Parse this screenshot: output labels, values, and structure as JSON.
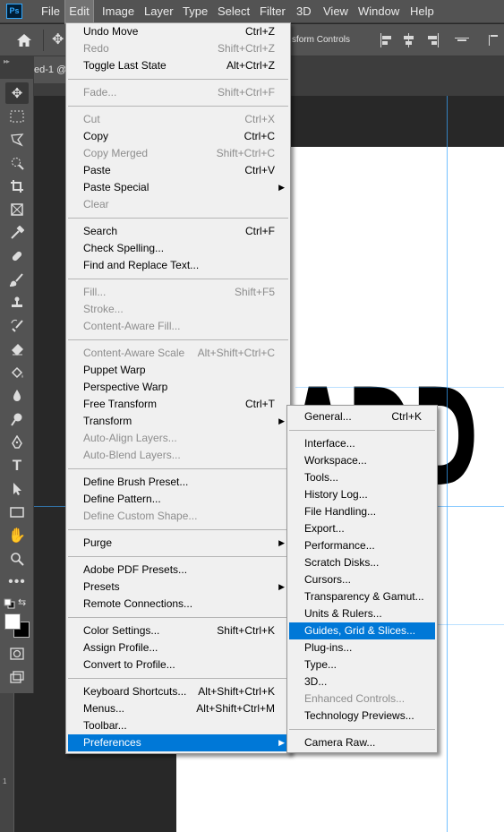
{
  "menubar": {
    "logo": "Ps",
    "items": [
      "File",
      "Edit",
      "Image",
      "Layer",
      "Type",
      "Select",
      "Filter",
      "3D",
      "View",
      "Window",
      "Help"
    ]
  },
  "options_bar": {
    "transform_controls": "sform Controls"
  },
  "document": {
    "tab_label": "ed-1 @",
    "canvas_text": "ADD",
    "ruler_number": "1"
  },
  "tools": [
    "move-tool",
    "marquee-tool",
    "lasso-tool",
    "quick-selection-tool",
    "crop-tool",
    "frame-tool",
    "eyedropper-tool",
    "healing-brush-tool",
    "brush-tool",
    "clone-stamp-tool",
    "history-brush-tool",
    "eraser-tool",
    "paint-bucket-tool",
    "blur-tool",
    "dodge-tool",
    "pen-tool",
    "type-tool",
    "path-selection-tool",
    "rectangle-tool",
    "hand-tool",
    "zoom-tool",
    "more-tools"
  ],
  "edit_menu": [
    {
      "label": "Undo Move",
      "shortcut": "Ctrl+Z",
      "enabled": true
    },
    {
      "label": "Redo",
      "shortcut": "Shift+Ctrl+Z",
      "enabled": false
    },
    {
      "label": "Toggle Last State",
      "shortcut": "Alt+Ctrl+Z",
      "enabled": true
    },
    {
      "separator": true
    },
    {
      "label": "Fade...",
      "shortcut": "Shift+Ctrl+F",
      "enabled": false
    },
    {
      "separator": true
    },
    {
      "label": "Cut",
      "shortcut": "Ctrl+X",
      "enabled": false
    },
    {
      "label": "Copy",
      "shortcut": "Ctrl+C",
      "enabled": true
    },
    {
      "label": "Copy Merged",
      "shortcut": "Shift+Ctrl+C",
      "enabled": false
    },
    {
      "label": "Paste",
      "shortcut": "Ctrl+V",
      "enabled": true
    },
    {
      "label": "Paste Special",
      "shortcut": "",
      "enabled": true,
      "submenu": true
    },
    {
      "label": "Clear",
      "shortcut": "",
      "enabled": false
    },
    {
      "separator": true
    },
    {
      "label": "Search",
      "shortcut": "Ctrl+F",
      "enabled": true
    },
    {
      "label": "Check Spelling...",
      "shortcut": "",
      "enabled": true
    },
    {
      "label": "Find and Replace Text...",
      "shortcut": "",
      "enabled": true
    },
    {
      "separator": true
    },
    {
      "label": "Fill...",
      "shortcut": "Shift+F5",
      "enabled": false
    },
    {
      "label": "Stroke...",
      "shortcut": "",
      "enabled": false
    },
    {
      "label": "Content-Aware Fill...",
      "shortcut": "",
      "enabled": false
    },
    {
      "separator": true
    },
    {
      "label": "Content-Aware Scale",
      "shortcut": "Alt+Shift+Ctrl+C",
      "enabled": false
    },
    {
      "label": "Puppet Warp",
      "shortcut": "",
      "enabled": true
    },
    {
      "label": "Perspective Warp",
      "shortcut": "",
      "enabled": true
    },
    {
      "label": "Free Transform",
      "shortcut": "Ctrl+T",
      "enabled": true
    },
    {
      "label": "Transform",
      "shortcut": "",
      "enabled": true,
      "submenu": true
    },
    {
      "label": "Auto-Align Layers...",
      "shortcut": "",
      "enabled": false
    },
    {
      "label": "Auto-Blend Layers...",
      "shortcut": "",
      "enabled": false
    },
    {
      "separator": true
    },
    {
      "label": "Define Brush Preset...",
      "shortcut": "",
      "enabled": true
    },
    {
      "label": "Define Pattern...",
      "shortcut": "",
      "enabled": true
    },
    {
      "label": "Define Custom Shape...",
      "shortcut": "",
      "enabled": false
    },
    {
      "separator": true
    },
    {
      "label": "Purge",
      "shortcut": "",
      "enabled": true,
      "submenu": true
    },
    {
      "separator": true
    },
    {
      "label": "Adobe PDF Presets...",
      "shortcut": "",
      "enabled": true
    },
    {
      "label": "Presets",
      "shortcut": "",
      "enabled": true,
      "submenu": true
    },
    {
      "label": "Remote Connections...",
      "shortcut": "",
      "enabled": true
    },
    {
      "separator": true
    },
    {
      "label": "Color Settings...",
      "shortcut": "Shift+Ctrl+K",
      "enabled": true
    },
    {
      "label": "Assign Profile...",
      "shortcut": "",
      "enabled": true
    },
    {
      "label": "Convert to Profile...",
      "shortcut": "",
      "enabled": true
    },
    {
      "separator": true
    },
    {
      "label": "Keyboard Shortcuts...",
      "shortcut": "Alt+Shift+Ctrl+K",
      "enabled": true
    },
    {
      "label": "Menus...",
      "shortcut": "Alt+Shift+Ctrl+M",
      "enabled": true
    },
    {
      "label": "Toolbar...",
      "shortcut": "",
      "enabled": true
    },
    {
      "label": "Preferences",
      "shortcut": "",
      "enabled": true,
      "submenu": true,
      "highlighted": true
    }
  ],
  "preferences_menu": [
    {
      "label": "General...",
      "shortcut": "Ctrl+K",
      "enabled": true
    },
    {
      "separator": true
    },
    {
      "label": "Interface...",
      "shortcut": "",
      "enabled": true
    },
    {
      "label": "Workspace...",
      "shortcut": "",
      "enabled": true
    },
    {
      "label": "Tools...",
      "shortcut": "",
      "enabled": true
    },
    {
      "label": "History Log...",
      "shortcut": "",
      "enabled": true
    },
    {
      "label": "File Handling...",
      "shortcut": "",
      "enabled": true
    },
    {
      "label": "Export...",
      "shortcut": "",
      "enabled": true
    },
    {
      "label": "Performance...",
      "shortcut": "",
      "enabled": true
    },
    {
      "label": "Scratch Disks...",
      "shortcut": "",
      "enabled": true
    },
    {
      "label": "Cursors...",
      "shortcut": "",
      "enabled": true
    },
    {
      "label": "Transparency & Gamut...",
      "shortcut": "",
      "enabled": true
    },
    {
      "label": "Units & Rulers...",
      "shortcut": "",
      "enabled": true
    },
    {
      "label": "Guides, Grid & Slices...",
      "shortcut": "",
      "enabled": true,
      "highlighted": true
    },
    {
      "label": "Plug-ins...",
      "shortcut": "",
      "enabled": true
    },
    {
      "label": "Type...",
      "shortcut": "",
      "enabled": true
    },
    {
      "label": "3D...",
      "shortcut": "",
      "enabled": true
    },
    {
      "label": "Enhanced Controls...",
      "shortcut": "",
      "enabled": false
    },
    {
      "label": "Technology Previews...",
      "shortcut": "",
      "enabled": true
    },
    {
      "separator": true
    },
    {
      "label": "Camera Raw...",
      "shortcut": "",
      "enabled": true
    }
  ],
  "colors": {
    "highlight": "#0078d7",
    "menu_bg": "#f0f0f0",
    "disabled_text": "#8d8d8d",
    "ui_panel": "#535353",
    "guide": "#3aa7ff",
    "foreground_swatch": "#ffffff",
    "background_swatch": "#000000"
  }
}
